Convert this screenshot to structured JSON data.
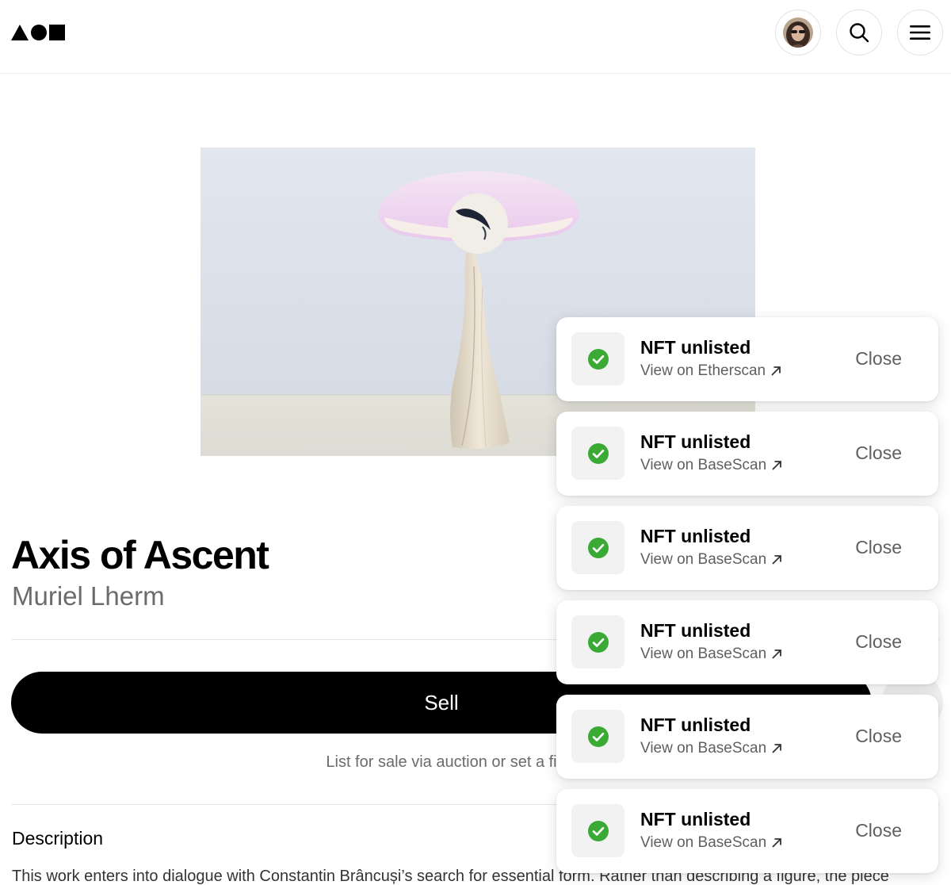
{
  "header": {
    "logo": "logo-triangle-circle-square-icon",
    "avatar_icon": "user-avatar",
    "search_icon": "search-icon",
    "menu_icon": "hamburger-menu-icon"
  },
  "artwork": {
    "subject": "lamp-sculpture-image"
  },
  "artwork_title": "Axis of Ascent",
  "artist": "Muriel Lherm",
  "sell": {
    "label": "Sell",
    "hint": "List for sale via auction or set a fi"
  },
  "description": {
    "heading": "Description",
    "text": "This work enters into dialogue with Constantin Brâncuși’s search for essential form. Rather than describing a figure, the piece"
  },
  "toasts": [
    {
      "title": "NFT unlisted",
      "link": "View on Etherscan",
      "close": "Close"
    },
    {
      "title": "NFT unlisted",
      "link": "View on BaseScan",
      "close": "Close"
    },
    {
      "title": "NFT unlisted",
      "link": "View on BaseScan",
      "close": "Close"
    },
    {
      "title": "NFT unlisted",
      "link": "View on BaseScan",
      "close": "Close"
    },
    {
      "title": "NFT unlisted",
      "link": "View on BaseScan",
      "close": "Close"
    },
    {
      "title": "NFT unlisted",
      "link": "View on BaseScan",
      "close": "Close"
    }
  ],
  "colors": {
    "success": "#3aaa35",
    "primary_button": "#000000",
    "muted_text": "#6b6b6b"
  }
}
